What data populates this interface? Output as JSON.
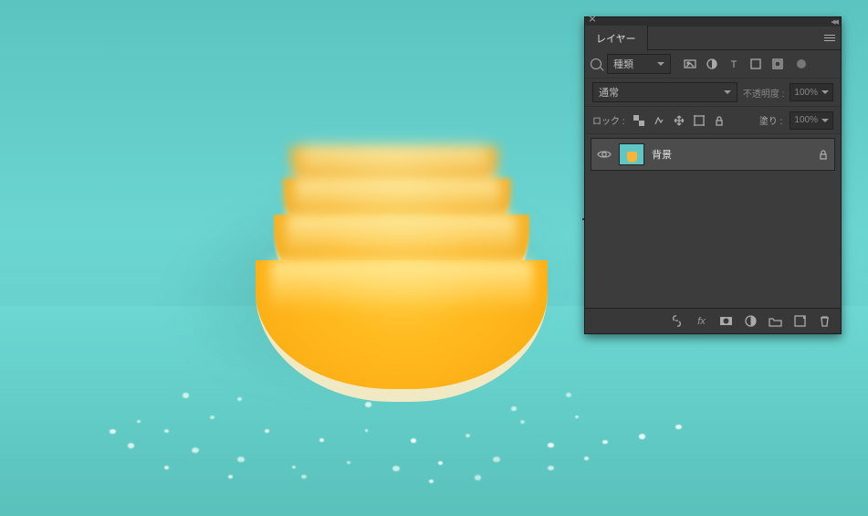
{
  "panel": {
    "title": "レイヤー",
    "filter_label": "種類",
    "filter_icons": [
      "pixel-layer-filter-icon",
      "adjustment-layer-filter-icon",
      "type-layer-filter-icon",
      "shape-layer-filter-icon",
      "smart-object-filter-icon"
    ],
    "blend_mode": "通常",
    "opacity_label": "不透明度 :",
    "opacity_value": "100%",
    "lock_label": "ロック :",
    "fill_label": "塗り :",
    "fill_value": "100%",
    "layer": {
      "name": "背景",
      "visible": true,
      "locked": true
    },
    "footer_icons": [
      "link-layers-icon",
      "layer-effects-icon",
      "layer-mask-icon",
      "adjustment-layer-icon",
      "group-icon",
      "new-layer-icon",
      "delete-layer-icon"
    ]
  },
  "cursor": {
    "type": "create-new"
  }
}
